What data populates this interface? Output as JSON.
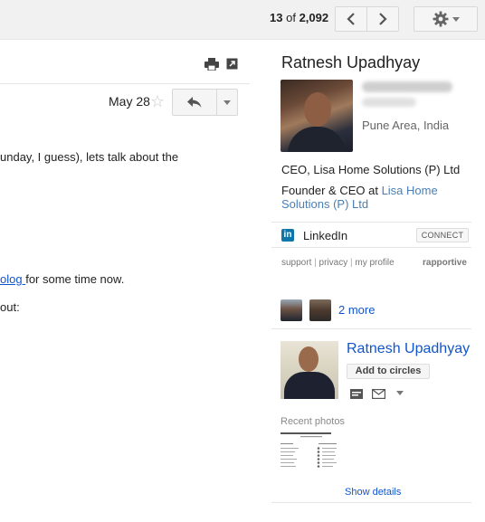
{
  "toolbar": {
    "counter_current": "13",
    "counter_of": "of",
    "counter_total": "2,092",
    "prev_icon": "chevron-left-icon",
    "next_icon": "chevron-right-icon",
    "settings_icon": "gear-icon"
  },
  "message": {
    "date": "May 28",
    "body_line1": "unday, I guess), lets talk about the",
    "body_link": "olog ",
    "body_line2_rest": "for some time now.",
    "body_line3": "out:"
  },
  "sidebar": {
    "name": "Ratnesh Upadhyay",
    "location": "Pune Area, India",
    "job1": "CEO, Lisa Home Solutions (P) Ltd",
    "job2_prefix": "Founder & CEO at ",
    "job2_company": "Lisa Home Solutions (P) Ltd",
    "linkedin_icon_text": "in",
    "linkedin_label": "LinkedIn",
    "connect_label": "CONNECT",
    "footer": {
      "support": "support",
      "privacy": "privacy",
      "my_profile": "my profile",
      "sep": " | ",
      "brand": "rapportive"
    },
    "more_people": "2 more",
    "gplus_name": "Ratnesh Upadhyay",
    "add_circles": "Add to circles",
    "recent_photos": "Recent photos",
    "show_details": "Show details"
  },
  "colors": {
    "link": "#1155cc",
    "linkedin": "#0e76a8"
  }
}
